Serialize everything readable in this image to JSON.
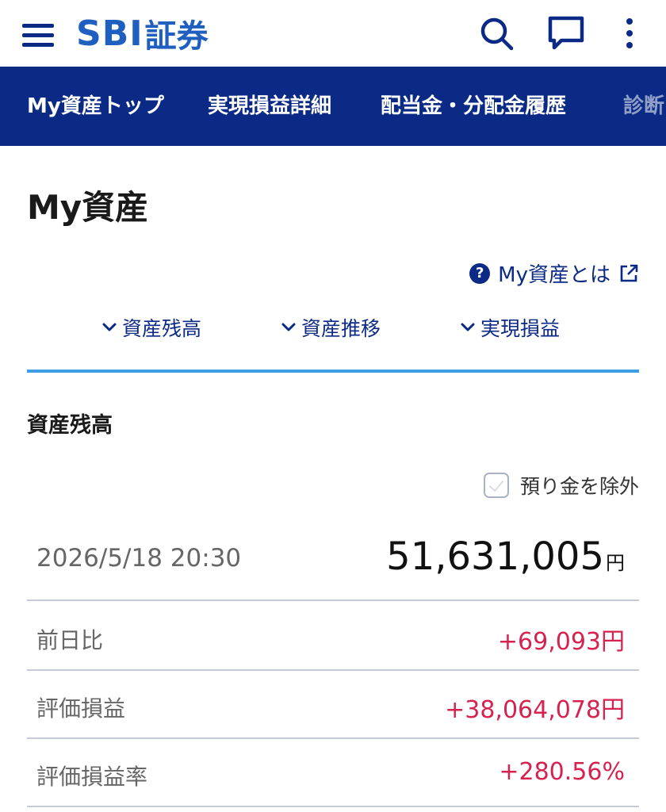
{
  "header": {
    "logo_latin": "SBI",
    "logo_jp": "証券",
    "icons": [
      "menu-icon",
      "search-icon",
      "chat-icon",
      "more-vertical-icon"
    ]
  },
  "tabs": [
    {
      "label": "My資産トップ"
    },
    {
      "label": "実現損益詳細"
    },
    {
      "label": "配当金・分配金履歴"
    },
    {
      "label": "診断"
    }
  ],
  "page": {
    "title": "My資産",
    "help_link": "My資産とは"
  },
  "anchors": [
    {
      "label": "資産残高"
    },
    {
      "label": "資産推移"
    },
    {
      "label": "実現損益"
    }
  ],
  "balance": {
    "section_title": "資産残高",
    "exclude_label": "預り金を除外",
    "exclude_checked": false,
    "datetime": "2026/5/18 20:30",
    "total": "51,631,005",
    "currency": "円",
    "rows": [
      {
        "label": "前日比",
        "value": "+69,093円"
      },
      {
        "label": "評価損益",
        "value": "+38,064,078円"
      },
      {
        "label": "評価損益率",
        "value": "+280.56%"
      }
    ]
  },
  "colors": {
    "brand_navy": "#0b2a86",
    "logo_blue": "#1f5fbf",
    "accent_blue": "#3d9ee3",
    "gain_red": "#d6224f"
  }
}
